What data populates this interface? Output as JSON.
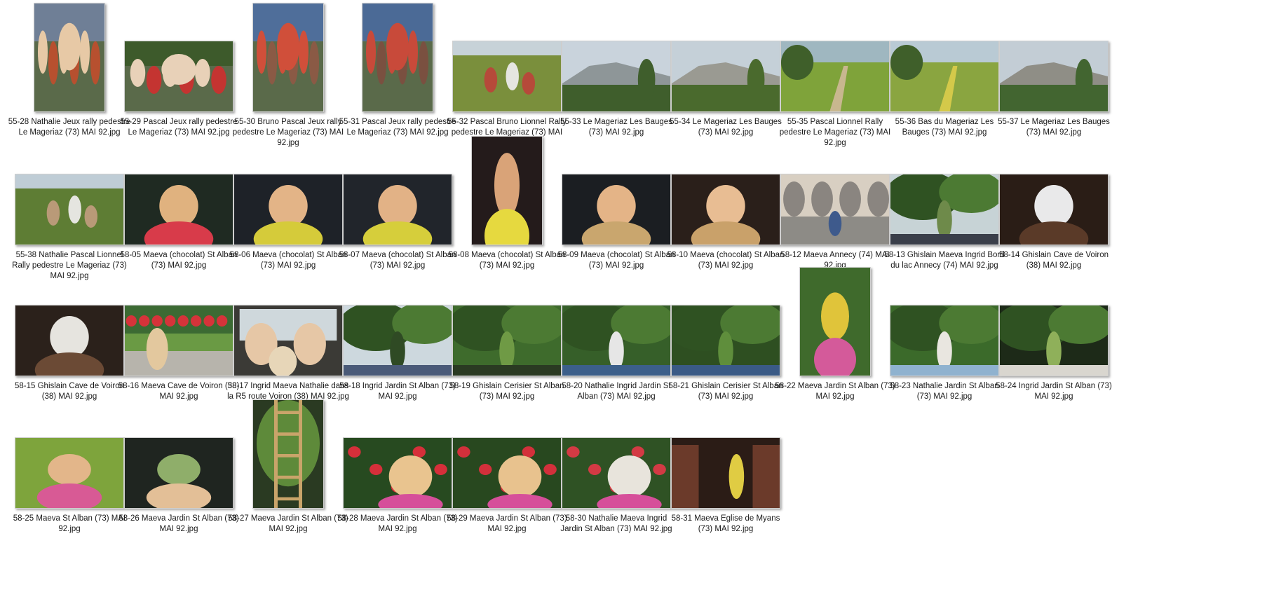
{
  "files": [
    {
      "name": "55-28 Nathalie Jeux rally pedestre Le Mageriaz (73) MAI 92.jpg",
      "orientation": "portrait",
      "scene": "people",
      "palette": [
        "#6f7f96",
        "#b7502f",
        "#e7c9a6"
      ]
    },
    {
      "name": "55-29 Pascal Jeux rally pedestre Le Mageriaz (73) MAI 92.jpg",
      "orientation": "landscape",
      "scene": "people",
      "palette": [
        "#3d5a2b",
        "#c43431",
        "#e8d1b8"
      ]
    },
    {
      "name": "55-30 Bruno Pascal Jeux rally pedestre Le Mageriaz (73) MAI 92.jpg",
      "orientation": "portrait",
      "scene": "crowd",
      "palette": [
        "#4f6e9a",
        "#8a5a45",
        "#d04f3a"
      ]
    },
    {
      "name": "55-31 Pascal Jeux rally pedestre Le Mageriaz (73) MAI 92.jpg",
      "orientation": "portrait",
      "scene": "crowd",
      "palette": [
        "#4b6a96",
        "#7a5040",
        "#c84a3a"
      ]
    },
    {
      "name": "55-32 Pascal Bruno Lionnel Rally pedestre Le Mageriaz (73) MAI 92.jpg",
      "orientation": "landscape",
      "scene": "meadow-people",
      "palette": [
        "#c7d2d8",
        "#7a8f3c",
        "#b64a3a"
      ]
    },
    {
      "name": "55-33 Le Mageriaz Les Bauges (73) MAI 92.jpg",
      "orientation": "landscape",
      "scene": "mountain",
      "palette": [
        "#c9d3dc",
        "#8e9698",
        "#3f5e2c"
      ]
    },
    {
      "name": "55-34 Le Mageriaz Les Bauges (73) MAI 92.jpg",
      "orientation": "landscape",
      "scene": "mountain",
      "palette": [
        "#c5d0d8",
        "#9a9a92",
        "#4a6a2d"
      ]
    },
    {
      "name": "55-35 Pascal Lionnel Rally pedestre Le Mageriaz (73) MAI 92.jpg",
      "orientation": "landscape",
      "scene": "field-path",
      "palette": [
        "#9fb7c0",
        "#7fa33a",
        "#c8b78f"
      ]
    },
    {
      "name": "55-36 Bas du Mageriaz Les Bauges (73) MAI 92.jpg",
      "orientation": "landscape",
      "scene": "field",
      "palette": [
        "#b9cad4",
        "#8aa540",
        "#d4c94a"
      ]
    },
    {
      "name": "55-37 Le Mageriaz Les Bauges (73) MAI 92.jpg",
      "orientation": "landscape",
      "scene": "mountain",
      "palette": [
        "#c3cdd5",
        "#8f8e86",
        "#426530"
      ]
    },
    {
      "name": "55-38 Nathalie Pascal Lionnel Rally pedestre Le Mageriaz (73) MAI 92.jpg",
      "orientation": "landscape",
      "scene": "path-people",
      "palette": [
        "#bfcdd6",
        "#5e7d34",
        "#b99a78"
      ]
    },
    {
      "name": "58-05 Maeva (chocolat) St Alban (73) MAI 92.jpg",
      "orientation": "landscape",
      "scene": "child-dark",
      "palette": [
        "#1f2a22",
        "#e0b27f",
        "#d83b4a"
      ]
    },
    {
      "name": "58-06 Maeva (chocolat) St Alban (73) MAI 92.jpg",
      "orientation": "landscape",
      "scene": "child-dark",
      "palette": [
        "#1e2228",
        "#e3b487",
        "#d5cb3a"
      ]
    },
    {
      "name": "58-07 Maeva (chocolat) St Alban (73) MAI 92.jpg",
      "orientation": "landscape",
      "scene": "child-dark",
      "palette": [
        "#21252b",
        "#e2b286",
        "#d6ce3b"
      ]
    },
    {
      "name": "58-08 Maeva (chocolat) St Alban (73) MAI 92.jpg",
      "orientation": "portrait",
      "scene": "child-dark",
      "palette": [
        "#241b1b",
        "#d9a378",
        "#e6d93f"
      ]
    },
    {
      "name": "58-09 Maeva (chocolat) St Alban (73) MAI 92.jpg",
      "orientation": "landscape",
      "scene": "child-dark",
      "palette": [
        "#1b1e22",
        "#e4b487",
        "#c9a66e"
      ]
    },
    {
      "name": "58-10 Maeva (chocolat) St Alban (73) MAI 92.jpg",
      "orientation": "landscape",
      "scene": "child-dark",
      "palette": [
        "#2a1f1a",
        "#e8bd93",
        "#c9a16a"
      ]
    },
    {
      "name": "58-12 Maeva Annecy (74) MAI 92.jpg",
      "orientation": "landscape",
      "scene": "arcade",
      "palette": [
        "#d8cfc2",
        "#8a8580",
        "#3e5a8c"
      ]
    },
    {
      "name": "58-13 Ghislain Maeva Ingrid Bord du lac Annecy (74) MAI 92.jpg",
      "orientation": "landscape",
      "scene": "lake-people",
      "palette": [
        "#c7d3d6",
        "#6e8a4a",
        "#3a3f4a"
      ]
    },
    {
      "name": "58-14 Ghislain Cave de Voiron (38) MAI 92.jpg",
      "orientation": "landscape",
      "scene": "interior-dark",
      "palette": [
        "#2a1d16",
        "#e9e9ea",
        "#5a3a28"
      ]
    },
    {
      "name": "58-15 Ghislain Cave de Voiron (38) MAI 92.jpg",
      "orientation": "landscape",
      "scene": "interior-dark",
      "palette": [
        "#2b211b",
        "#e6e4df",
        "#6b4a35"
      ]
    },
    {
      "name": "58-16 Maeva Cave de Voiron (38) MAI 92.jpg",
      "orientation": "landscape",
      "scene": "flowers-wall",
      "palette": [
        "#3c6a33",
        "#d6333a",
        "#b7b4ac"
      ]
    },
    {
      "name": "58-17 Ingrid Maeva Nathalie dans la R5 route Voiron (38) MAI 92.jpg",
      "orientation": "landscape",
      "scene": "car-interior",
      "palette": [
        "#cfd8dc",
        "#e6c7a6",
        "#5c6a4a"
      ]
    },
    {
      "name": "58-18 Ingrid Jardin St Alban (73) MAI 92.jpg",
      "orientation": "landscape",
      "scene": "garden",
      "palette": [
        "#cdd8de",
        "#2f4a24",
        "#4a5a78"
      ]
    },
    {
      "name": "58-19 Ghislain Cerisier St Alban (73) MAI 92.jpg",
      "orientation": "landscape",
      "scene": "tree",
      "palette": [
        "#3e6b2c",
        "#6f9a45",
        "#2a3a22"
      ]
    },
    {
      "name": "58-20 Nathalie Ingrid Jardin St Alban (73) MAI 92.jpg",
      "orientation": "landscape",
      "scene": "tree",
      "palette": [
        "#365f29",
        "#e6e6e6",
        "#3c5f8a"
      ]
    },
    {
      "name": "58-21 Ghislain Cerisier St Alban (73) MAI 92.jpg",
      "orientation": "landscape",
      "scene": "tree",
      "palette": [
        "#2e4f21",
        "#5f8e3c",
        "#3a5a86"
      ]
    },
    {
      "name": "58-22 Maeva Jardin St Alban (73) MAI 92.jpg",
      "orientation": "portrait",
      "scene": "child-garden",
      "palette": [
        "#3f6a2c",
        "#e0c43a",
        "#d45a9a"
      ]
    },
    {
      "name": "58-23 Nathalie Jardin St Alban (73) MAI 92.jpg",
      "orientation": "landscape",
      "scene": "garden",
      "palette": [
        "#3b6a2a",
        "#e9e6e0",
        "#8fb2cf"
      ]
    },
    {
      "name": "58-24 Ingrid Jardin St Alban (73) MAI 92.jpg",
      "orientation": "landscape",
      "scene": "tree-dark",
      "palette": [
        "#1d2a18",
        "#8fb05a",
        "#d9d6cf"
      ]
    },
    {
      "name": "58-25 Maeva St Alban (73) MAI 92.jpg",
      "orientation": "landscape",
      "scene": "child-grass",
      "palette": [
        "#7ea43c",
        "#e3b68a",
        "#d85a95"
      ]
    },
    {
      "name": "58-26 Maeva Jardin St Alban (73) MAI 92.jpg",
      "orientation": "landscape",
      "scene": "child-window",
      "palette": [
        "#1f2520",
        "#8fae6a",
        "#e3bf97"
      ]
    },
    {
      "name": "58-27 Maeva Jardin St Alban (73) MAI 92.jpg",
      "orientation": "portrait",
      "scene": "ladder",
      "palette": [
        "#2a3a22",
        "#5e8a3a",
        "#c9a46a"
      ]
    },
    {
      "name": "58-28 Maeva Jardin St Alban (73) MAI 92.jpg",
      "orientation": "landscape",
      "scene": "child-roses",
      "palette": [
        "#274a20",
        "#d62f3a",
        "#e9c48f"
      ]
    },
    {
      "name": "58-29 Maeva Jardin St Alban (73) MAI 92.jpg",
      "orientation": "landscape",
      "scene": "child-roses",
      "palette": [
        "#28481f",
        "#d3303b",
        "#e8c28e"
      ]
    },
    {
      "name": "58-30 Nathalie Maeva Ingrid Jardin St Alban (73) MAI 92.jpg",
      "orientation": "landscape",
      "scene": "group-roses",
      "palette": [
        "#2f5224",
        "#d33a44",
        "#e8e4dc"
      ]
    },
    {
      "name": "58-31 Maeva Eglise de Myans (73) MAI 92.jpg",
      "orientation": "landscape",
      "scene": "church",
      "palette": [
        "#2b1c16",
        "#6b3a2a",
        "#e0cc43"
      ]
    }
  ],
  "layout_columns": 10
}
